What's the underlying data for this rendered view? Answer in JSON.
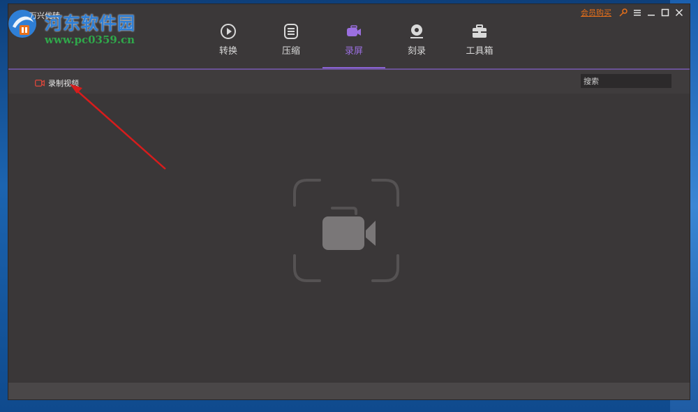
{
  "window": {
    "app_title": "万兴优转",
    "vip_link": "会员购买"
  },
  "watermark": {
    "site_name": "河东软件园",
    "url": "www.pc0359.cn"
  },
  "nav": {
    "items": [
      {
        "label": "转换",
        "icon": "play-circle-icon",
        "active": false
      },
      {
        "label": "压缩",
        "icon": "compress-icon",
        "active": false
      },
      {
        "label": "录屏",
        "icon": "record-camera-icon",
        "active": true
      },
      {
        "label": "刻录",
        "icon": "disc-burn-icon",
        "active": false
      },
      {
        "label": "工具箱",
        "icon": "toolbox-icon",
        "active": false
      }
    ],
    "active_color": "#9b6fe0"
  },
  "toolbar": {
    "record_video_label": "录制视频",
    "record_icon_color": "#e0473b",
    "search_placeholder": "搜索"
  },
  "annotation": {
    "arrow_color": "#d81c1c"
  }
}
